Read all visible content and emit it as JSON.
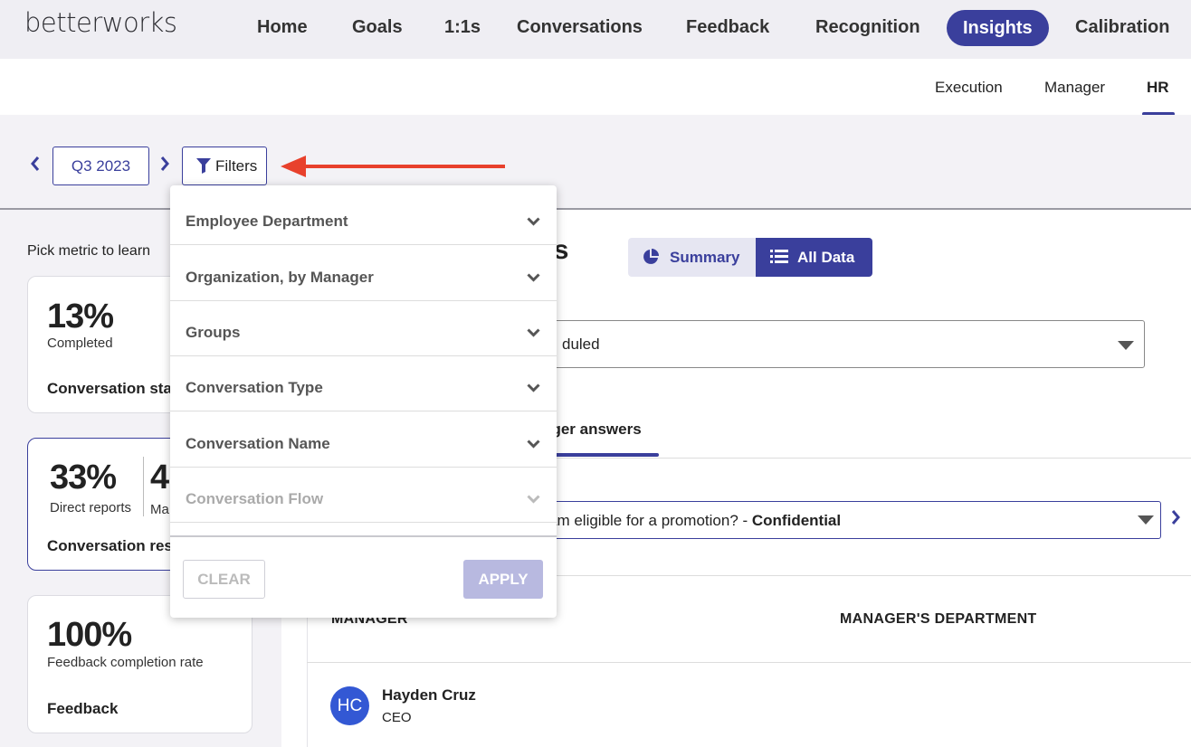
{
  "brand": {
    "logo_text": "betterworks",
    "accent": "#3a3f9c",
    "arrow_color": "#e8412c"
  },
  "topnav": {
    "items": [
      {
        "label": "Home"
      },
      {
        "label": "Goals"
      },
      {
        "label": "1:1s"
      },
      {
        "label": "Conversations"
      },
      {
        "label": "Feedback"
      },
      {
        "label": "Recognition"
      },
      {
        "label": "Insights",
        "active": true
      },
      {
        "label": "Calibration"
      }
    ]
  },
  "subnav": {
    "items": [
      {
        "label": "Execution"
      },
      {
        "label": "Manager"
      },
      {
        "label": "HR",
        "active": true
      }
    ]
  },
  "filterbar": {
    "period": "Q3 2023",
    "filters_label": "Filters",
    "prev_icon": "chevron-left-icon",
    "next_icon": "chevron-right-icon"
  },
  "left": {
    "pick_label": "Pick metric to learn",
    "cards": [
      {
        "value": "13%",
        "caption": "Completed",
        "title": "Conversation sta"
      },
      {
        "value": "33%",
        "caption": "Direct reports",
        "value2": "4",
        "caption2": "Ma",
        "title": "Conversation res",
        "selected": true
      },
      {
        "value": "100%",
        "caption": "Feedback completion rate",
        "title": "Feedback"
      }
    ]
  },
  "main": {
    "title": "nses",
    "toggle": {
      "summary": "Summary",
      "all_data": "All Data",
      "active": "All Data"
    },
    "select1_value": "duled",
    "tab_label": "ager answers",
    "question_text": "am eligible for a promotion? - ",
    "question_tag": "Confidential",
    "table": {
      "headers": [
        "MANAGER",
        "MANAGER'S DEPARTMENT"
      ],
      "rows": [
        {
          "initials": "HC",
          "name": "Hayden Cruz",
          "role": "CEO"
        }
      ]
    }
  },
  "filter_dropdown": {
    "items": [
      {
        "label": "Employee Department",
        "disabled": false
      },
      {
        "label": "Organization, by Manager",
        "disabled": false
      },
      {
        "label": "Groups",
        "disabled": false
      },
      {
        "label": "Conversation Type",
        "disabled": false
      },
      {
        "label": "Conversation Name",
        "disabled": false
      },
      {
        "label": "Conversation Flow",
        "disabled": true
      }
    ],
    "clear_label": "CLEAR",
    "apply_label": "APPLY"
  }
}
